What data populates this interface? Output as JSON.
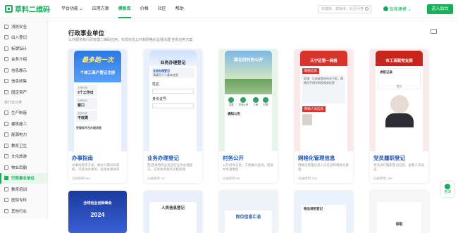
{
  "brand": {
    "name": "草料二维码",
    "color": "#1aad5a"
  },
  "nav": [
    {
      "label": "平台功能 ⌄"
    },
    {
      "label": "应用方案"
    },
    {
      "label": "模板库",
      "active": true
    },
    {
      "label": "价格"
    },
    {
      "label": "社区"
    },
    {
      "label": "帮助"
    }
  ],
  "search": {
    "placeholder": "找模板、模板库、社区问答"
  },
  "smart_label": "智能建模 ⌄",
  "login_label": "进入后台",
  "sidebar": {
    "top_items": [
      "消防安全",
      "出入登记",
      "标牌设计",
      "会务介绍",
      "信息展示",
      "信息收集",
      "固定资产"
    ],
    "group_label": "按行业分类",
    "industry_items": [
      "生产制造",
      "建筑施工",
      "能源电力",
      "教育卫生",
      "文化旅游",
      "物业后勤",
      "行政事业单位",
      "教育培训",
      "医院专科",
      "其他行业"
    ],
    "active": "行政事业单位"
  },
  "page": {
    "title": "行政事业单位",
    "desc": "公共服务和行政管理二维码应用，实现信息公开和网格化监督治理 查看应用方案"
  },
  "cards": [
    {
      "title": "办事指南",
      "desc": "办事指南等方式，群众只需扫码获取，可咨询办事等，提高办事效率",
      "uses": "已被使用 5K+",
      "screen": {
        "banner": "最多跑一次",
        "sub": "个体工商户登记注册",
        "rows": [
          [
            "办理时限",
            "3个工作日"
          ],
          [
            "办理地点",
            "窗口"
          ],
          [
            "收费标准",
            "不收费"
          ]
        ],
        "footer": "受理条件及办理流程"
      }
    },
    {
      "title": "业务办理登记",
      "desc": "西/西事项的业务进行业务办理登记，实现政务服务流程管理",
      "uses": "已被使用 7K",
      "screen": {
        "head": "业务办理登记",
        "field1": "姓名",
        "field2": "身份证号",
        "hint": "请填写个人基本信息"
      }
    },
    {
      "title": "村务公开",
      "desc": "公开村务信息，方便群众查询，提高村务透明度",
      "uses": "已被使用 6K",
      "screen": {
        "head": "湖北村村务公开",
        "icons": [
          "党建",
          "村务公开",
          "三资",
          "村规"
        ],
        "footer": "通知公告"
      }
    },
    {
      "title": "网格化管理信息",
      "desc": "网格化管理信息人员信息和网格化管理",
      "uses": "已被使用 17K",
      "screen": {
        "head": "天宁区第一网格",
        "sec1": "网格信息",
        "sec2": "网格人员信息",
        "text": "区域：江苏省常州市天宁区，网格员手机号码及相关信息"
      }
    },
    {
      "title": "党员履职登记",
      "desc": "党员进行履职登记信息，查看工作动态",
      "uses": "已被使用 16K",
      "screen": {
        "head": "市工商联党支部",
        "block": "述职记录",
        "btn": "提交"
      }
    }
  ],
  "row2": [
    {
      "banner": "全球创业创新峰会",
      "year": "2024"
    },
    {
      "banner": "人员信息登记",
      "sub": "人员信息汇总"
    },
    {
      "banner": "岗位信息汇总"
    },
    {
      "banner": "物品领用登记",
      "sub": "物品总数登记"
    },
    {
      "banner": "领取"
    }
  ],
  "fab": {
    "label": "咨询"
  }
}
